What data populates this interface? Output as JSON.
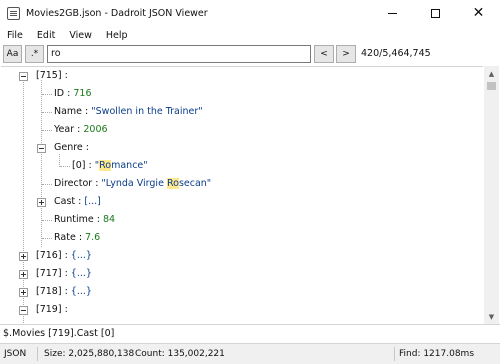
{
  "window": {
    "title": "Movies2GB.json - Dadroit JSON Viewer",
    "app_icon": "document-icon",
    "controls": [
      "minimize-icon",
      "maximize-icon",
      "close-icon"
    ],
    "close_glyph": "✕"
  },
  "menu": [
    "File",
    "Edit",
    "View",
    "Help"
  ],
  "search": {
    "case_button": "Aa",
    "regex_button": ".*",
    "query": "ro",
    "prev_button": "<",
    "next_button": ">",
    "match_count": "420/5,464,745"
  },
  "tree": {
    "node_715": "[715]",
    "node_715_colon": " :",
    "id": {
      "key": "ID",
      "sep": " : ",
      "value": "716"
    },
    "name": {
      "key": "Name",
      "sep": " : ",
      "value": "\"Swollen in the Trainer\""
    },
    "year": {
      "key": "Year",
      "sep": " : ",
      "value": "2006"
    },
    "genre": {
      "key": "Genre",
      "sep": " :"
    },
    "genre_item": {
      "key": "[0]",
      "sep": " : ",
      "quote_open": "\"",
      "match": "Ro",
      "rest": "mance\""
    },
    "director": {
      "key": "Director",
      "sep": " : ",
      "before": "\"Lynda Virgie ",
      "match": "Ro",
      "rest": "secan\""
    },
    "cast": {
      "key": "Cast",
      "sep": " : ",
      "value": "[...]"
    },
    "runtime": {
      "key": "Runtime",
      "sep": " : ",
      "value": "84"
    },
    "rate": {
      "key": "Rate",
      "sep": " : ",
      "value": "7.6"
    },
    "collapsed": [
      {
        "key": "[716]",
        "sep": " : ",
        "value": "{...}"
      },
      {
        "key": "[717]",
        "sep": " : ",
        "value": "{...}"
      },
      {
        "key": "[718]",
        "sep": " : ",
        "value": "{...}"
      }
    ],
    "node_719": {
      "key": "[719]",
      "sep": " :"
    }
  },
  "path": "$.Movies [719].Cast [0]",
  "status": {
    "format": "JSON",
    "size": "Size: 2,025,880,138",
    "count": "Count: 135,002,221",
    "find": "Find: 1217.08ms"
  },
  "colors": {
    "number": "#1a7a1a",
    "string": "#0b3d8a",
    "highlight": "#ffe98a"
  }
}
